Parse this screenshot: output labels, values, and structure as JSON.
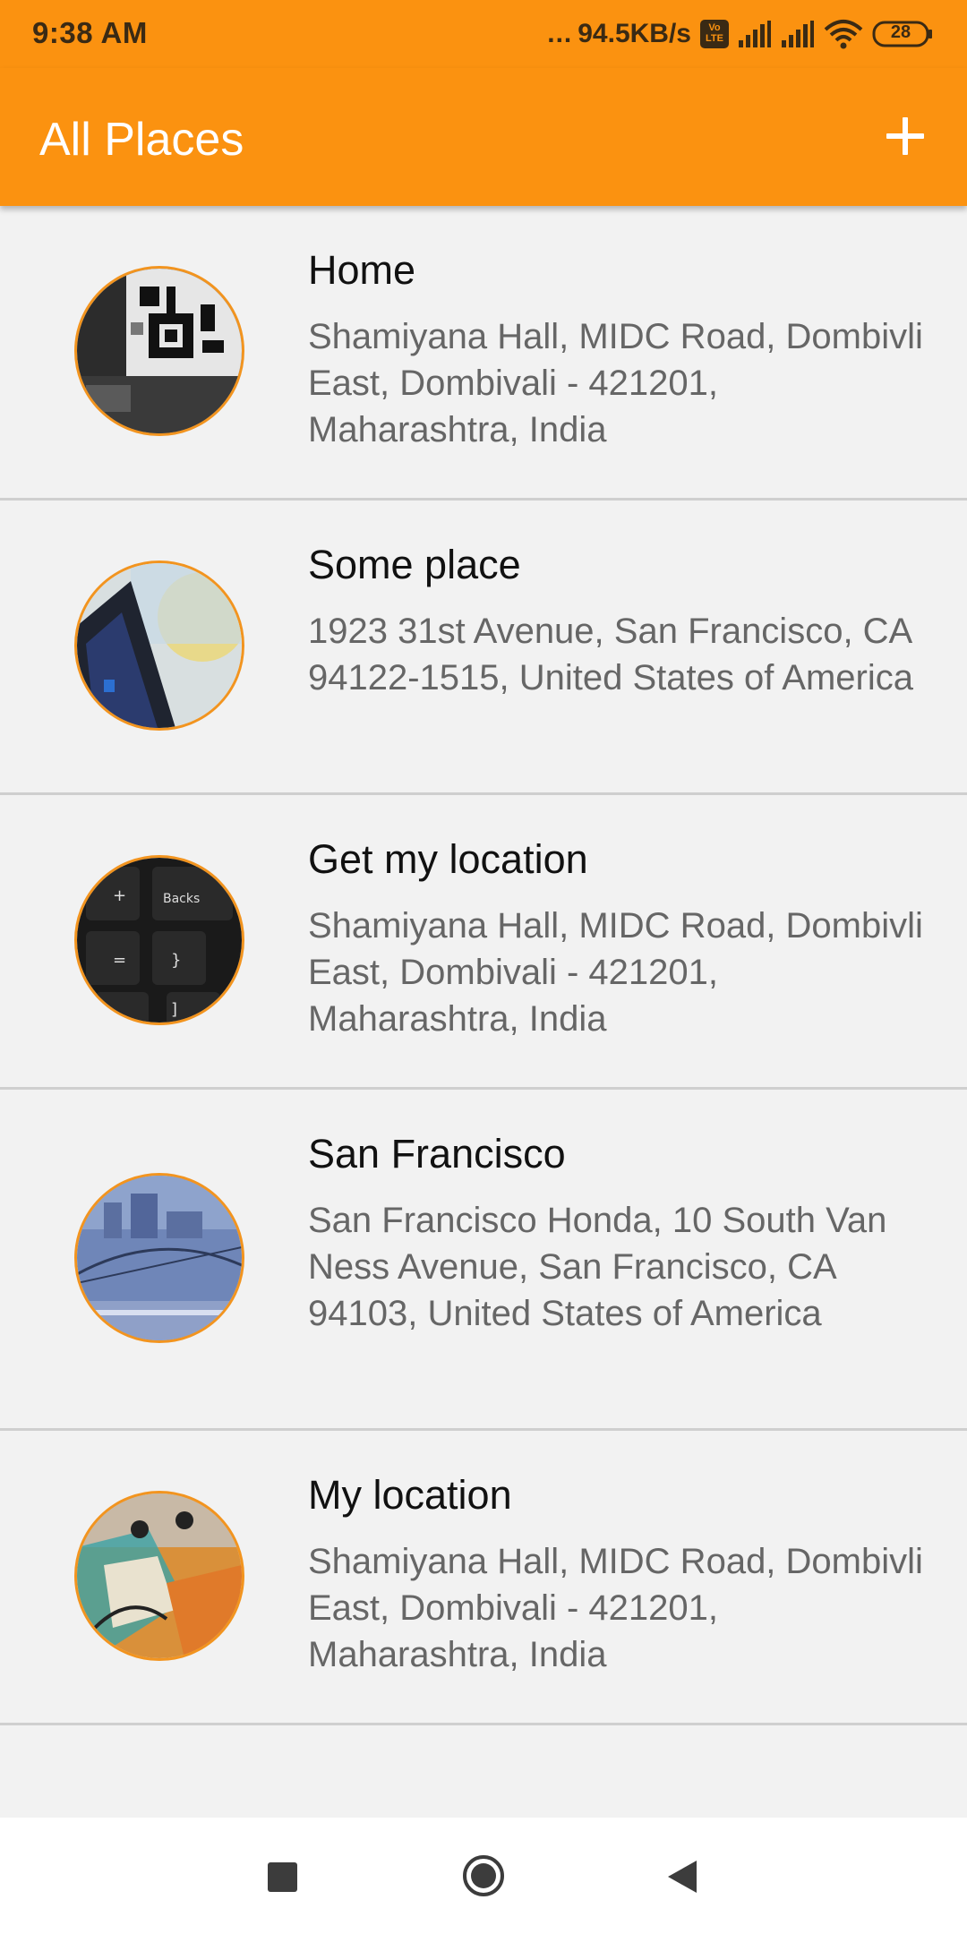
{
  "status_bar": {
    "time": "9:38 AM",
    "dots": "...",
    "net_speed": "94.5KB/s",
    "volte_label": "Vo LTE",
    "battery": "28"
  },
  "app_bar": {
    "title": "All Places",
    "add_icon": "plus-icon"
  },
  "places": [
    {
      "name": "Home",
      "address": "Shamiyana Hall, MIDC Road, Dombivli East, Dombivali - 421201, Maharashtra, India"
    },
    {
      "name": "Some place",
      "address": "1923 31st Avenue, San Francisco, CA 94122-1515, United States of America"
    },
    {
      "name": "Get my location",
      "address": "Shamiyana Hall, MIDC Road, Dombivli East, Dombivali - 421201, Maharashtra, India"
    },
    {
      "name": "San Francisco",
      "address": "San Francisco Honda, 10 South Van Ness Avenue, San Francisco, CA 94103, United States of America"
    },
    {
      "name": "My location",
      "address": "Shamiyana Hall, MIDC Road, Dombivli East, Dombivali - 421201, Maharashtra, India"
    }
  ],
  "nav_bar": {
    "recents_icon": "square-icon",
    "home_icon": "circle-icon",
    "back_icon": "triangle-back-icon"
  },
  "colors": {
    "accent": "#fb9210",
    "thumb_border": "#f2941f",
    "background": "#f2f2f2"
  }
}
